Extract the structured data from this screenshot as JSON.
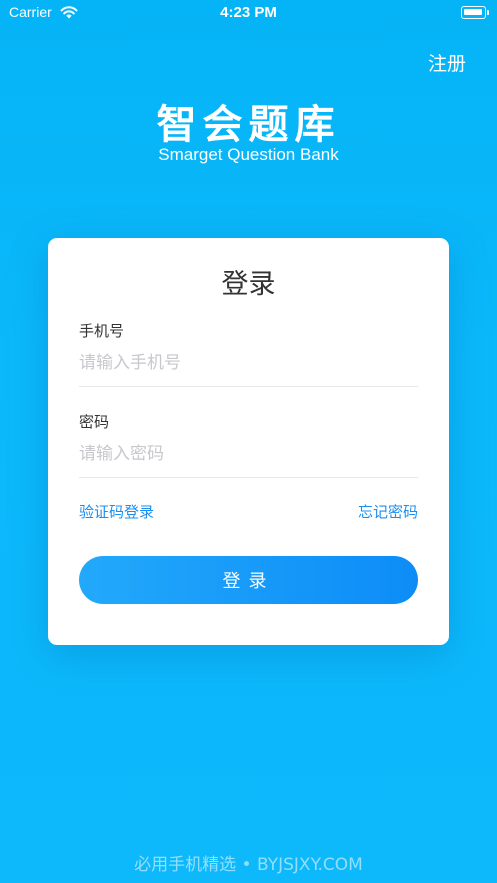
{
  "status_bar": {
    "carrier": "Carrier",
    "time": "4:23 PM"
  },
  "header": {
    "register_label": "注册",
    "app_title": "智会题库",
    "app_subtitle": "Smarget Question Bank"
  },
  "login_card": {
    "title": "登录",
    "phone": {
      "label": "手机号",
      "placeholder": "请输入手机号",
      "value": ""
    },
    "password": {
      "label": "密码",
      "placeholder": "请输入密码",
      "value": ""
    },
    "sms_login_label": "验证码登录",
    "forgot_password_label": "忘记密码",
    "login_button_label": "登录"
  },
  "watermark": "必用手机精选 • BYJSJXY.COM",
  "colors": {
    "background": "#0bb9fb",
    "accent": "#1a8ff0",
    "button": "#0d8cf7"
  }
}
